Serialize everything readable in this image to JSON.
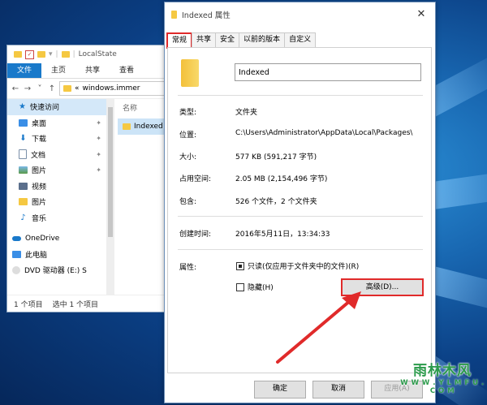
{
  "explorer": {
    "title": "LocalState",
    "ribbon_tabs": [
      "文件",
      "主页",
      "共享",
      "查看"
    ],
    "address": "windows.immer",
    "address_prefix": "«",
    "nav_items": [
      {
        "label": "快速访问",
        "icon": "star-icon",
        "pinned": false
      },
      {
        "label": "桌面",
        "icon": "desktop-icon",
        "pinned": true
      },
      {
        "label": "下载",
        "icon": "download-icon",
        "pinned": true
      },
      {
        "label": "文档",
        "icon": "document-icon",
        "pinned": true
      },
      {
        "label": "图片",
        "icon": "picture-icon",
        "pinned": true
      },
      {
        "label": "视频",
        "icon": "video-icon",
        "pinned": false
      },
      {
        "label": "图片",
        "icon": "folder-icon",
        "pinned": false
      },
      {
        "label": "音乐",
        "icon": "music-icon",
        "pinned": false
      },
      {
        "label": "OneDrive",
        "icon": "cloud-icon",
        "pinned": false
      },
      {
        "label": "此电脑",
        "icon": "computer-icon",
        "pinned": false
      },
      {
        "label": "DVD 驱动器 (E:) S",
        "icon": "dvd-icon",
        "pinned": false
      }
    ],
    "column_header": "名称",
    "file": "Indexed",
    "status_count": "1 个项目",
    "status_selected": "选中 1 个项目"
  },
  "dialog": {
    "title": "Indexed 属性",
    "tabs": [
      "常规",
      "共享",
      "安全",
      "以前的版本",
      "自定义"
    ],
    "name_value": "Indexed",
    "rows": [
      {
        "label": "类型:",
        "value": "文件夹"
      },
      {
        "label": "位置:",
        "value": "C:\\Users\\Administrator\\AppData\\Local\\Packages\\"
      },
      {
        "label": "大小:",
        "value": "577 KB (591,217 字节)"
      },
      {
        "label": "占用空间:",
        "value": "2.05 MB (2,154,496 字节)"
      },
      {
        "label": "包含:",
        "value": "526 个文件，2 个文件夹"
      },
      {
        "label": "创建时间:",
        "value": "2016年5月11日，13:34:33"
      }
    ],
    "attr_label": "属性:",
    "readonly_label": "只读(仅应用于文件夹中的文件)(R)",
    "hidden_label": "隐藏(H)",
    "advanced_button": "高级(D)...",
    "ok_button": "确定",
    "cancel_button": "取消",
    "apply_button": "应用(A)",
    "close_glyph": "✕"
  },
  "watermark": {
    "title": "雨林木风",
    "url": "W W W . Y L M F U . C O M"
  },
  "colors": {
    "accent": "#1979ca",
    "highlight": "#e02a2a",
    "folder": "#f5c842"
  }
}
